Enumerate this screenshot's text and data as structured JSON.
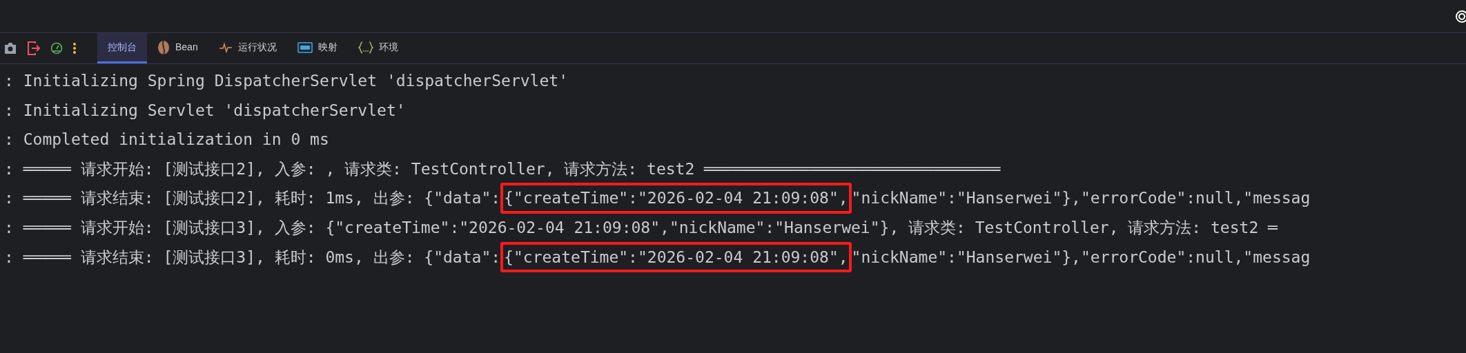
{
  "tabs": [
    {
      "label": "控制台",
      "selected": true,
      "kind": "console"
    },
    {
      "label": "Bean",
      "selected": false,
      "kind": "bean"
    },
    {
      "label": "运行状况",
      "selected": false,
      "kind": "health"
    },
    {
      "label": "映射",
      "selected": false,
      "kind": "mapping"
    },
    {
      "label": "环境",
      "selected": false,
      "kind": "env"
    }
  ],
  "log_lines": [
    {
      "segments": [
        {
          "text": ": Initializing Spring DispatcherServlet 'dispatcherServlet'",
          "highlighted": false
        }
      ]
    },
    {
      "segments": [
        {
          "text": ": Initializing Servlet 'dispatcherServlet'",
          "highlighted": false
        }
      ]
    },
    {
      "segments": [
        {
          "text": ": Completed initialization in 0 ms",
          "highlighted": false
        }
      ]
    },
    {
      "segments": [
        {
          "text": ": ═════ 请求开始: [测试接口2], 入参: , 请求类: TestController, 请求方法: test2 ═══════════════════════════════",
          "highlighted": false
        }
      ]
    },
    {
      "segments": [
        {
          "text": ": ═════ 请求结束: [测试接口2], 耗时: 1ms, 出参: {\"data\":",
          "highlighted": false
        },
        {
          "text": "{\"createTime\":\"2026-02-04 21:09:08\",",
          "highlighted": true
        },
        {
          "text": "\"nickName\":\"Hanserwei\"},\"errorCode\":null,\"messag",
          "highlighted": false
        }
      ]
    },
    {
      "segments": [
        {
          "text": ": ═════ 请求开始: [测试接口3], 入参: {\"createTime\":\"2026-02-04 21:09:08\",\"nickName\":\"Hanserwei\"}, 请求类: TestController, 请求方法: test2 ═",
          "highlighted": false
        }
      ]
    },
    {
      "segments": [
        {
          "text": ": ═════ 请求结束: [测试接口3], 耗时: 0ms, 出参: {\"data\":",
          "highlighted": false
        },
        {
          "text": "{\"createTime\":\"2026-02-04 21:09:08\",",
          "highlighted": true
        },
        {
          "text": "\"nickName\":\"Hanserwei\"},\"errorCode\":null,\"messag",
          "highlighted": false
        }
      ]
    }
  ]
}
